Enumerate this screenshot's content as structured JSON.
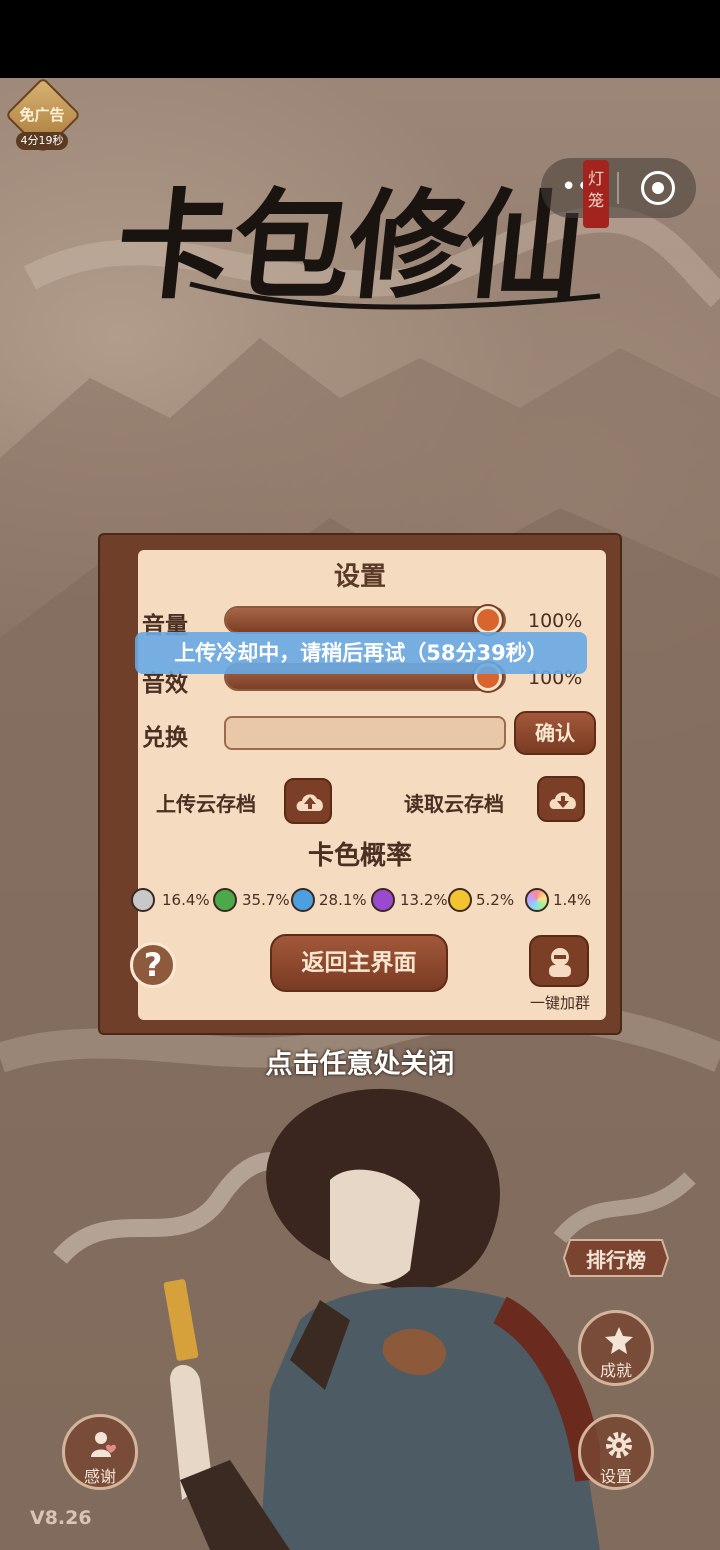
{
  "top_left_badge": {
    "label": "免广告",
    "timer": "4分19秒"
  },
  "capsule": {
    "menu_icon": "more-dots-icon",
    "close_icon": "target-icon"
  },
  "seal": {
    "text": "灯笼"
  },
  "game_logo": {
    "text": "卡包修仙"
  },
  "settings_panel": {
    "title": "设置",
    "volume": {
      "label": "音量",
      "value_percent": 100,
      "display": "100%"
    },
    "sound_effects": {
      "label": "音效",
      "value_percent": 100,
      "display": "100%"
    },
    "redeem": {
      "label": "兑换",
      "input_value": "",
      "confirm_label": "确认"
    },
    "cloud": {
      "upload_label": "上传云存档",
      "download_label": "读取云存档"
    },
    "card_color_rates": {
      "title": "卡色概率",
      "items": [
        {
          "color": "#c8c8c8",
          "value": "16.4%"
        },
        {
          "color": "#4da84a",
          "value": "35.7%"
        },
        {
          "color": "#4da0e0",
          "value": "28.1%"
        },
        {
          "color": "#9b4ad0",
          "value": "13.2%"
        },
        {
          "color": "#f4c430",
          "value": "5.2%"
        },
        {
          "color": "rainbow",
          "value": "1.4%"
        }
      ]
    },
    "home_button": "返回主界面",
    "group_label": "一键加群",
    "help_symbol": "?"
  },
  "toast": {
    "text": "上传冷却中，请稍后再试（58分39秒）"
  },
  "close_hint": "点击任意处关闭",
  "side_buttons": {
    "ranking": "排行榜",
    "achievements": "成就",
    "settings": "设置",
    "thanks": "感谢"
  },
  "version": "V8.26"
}
